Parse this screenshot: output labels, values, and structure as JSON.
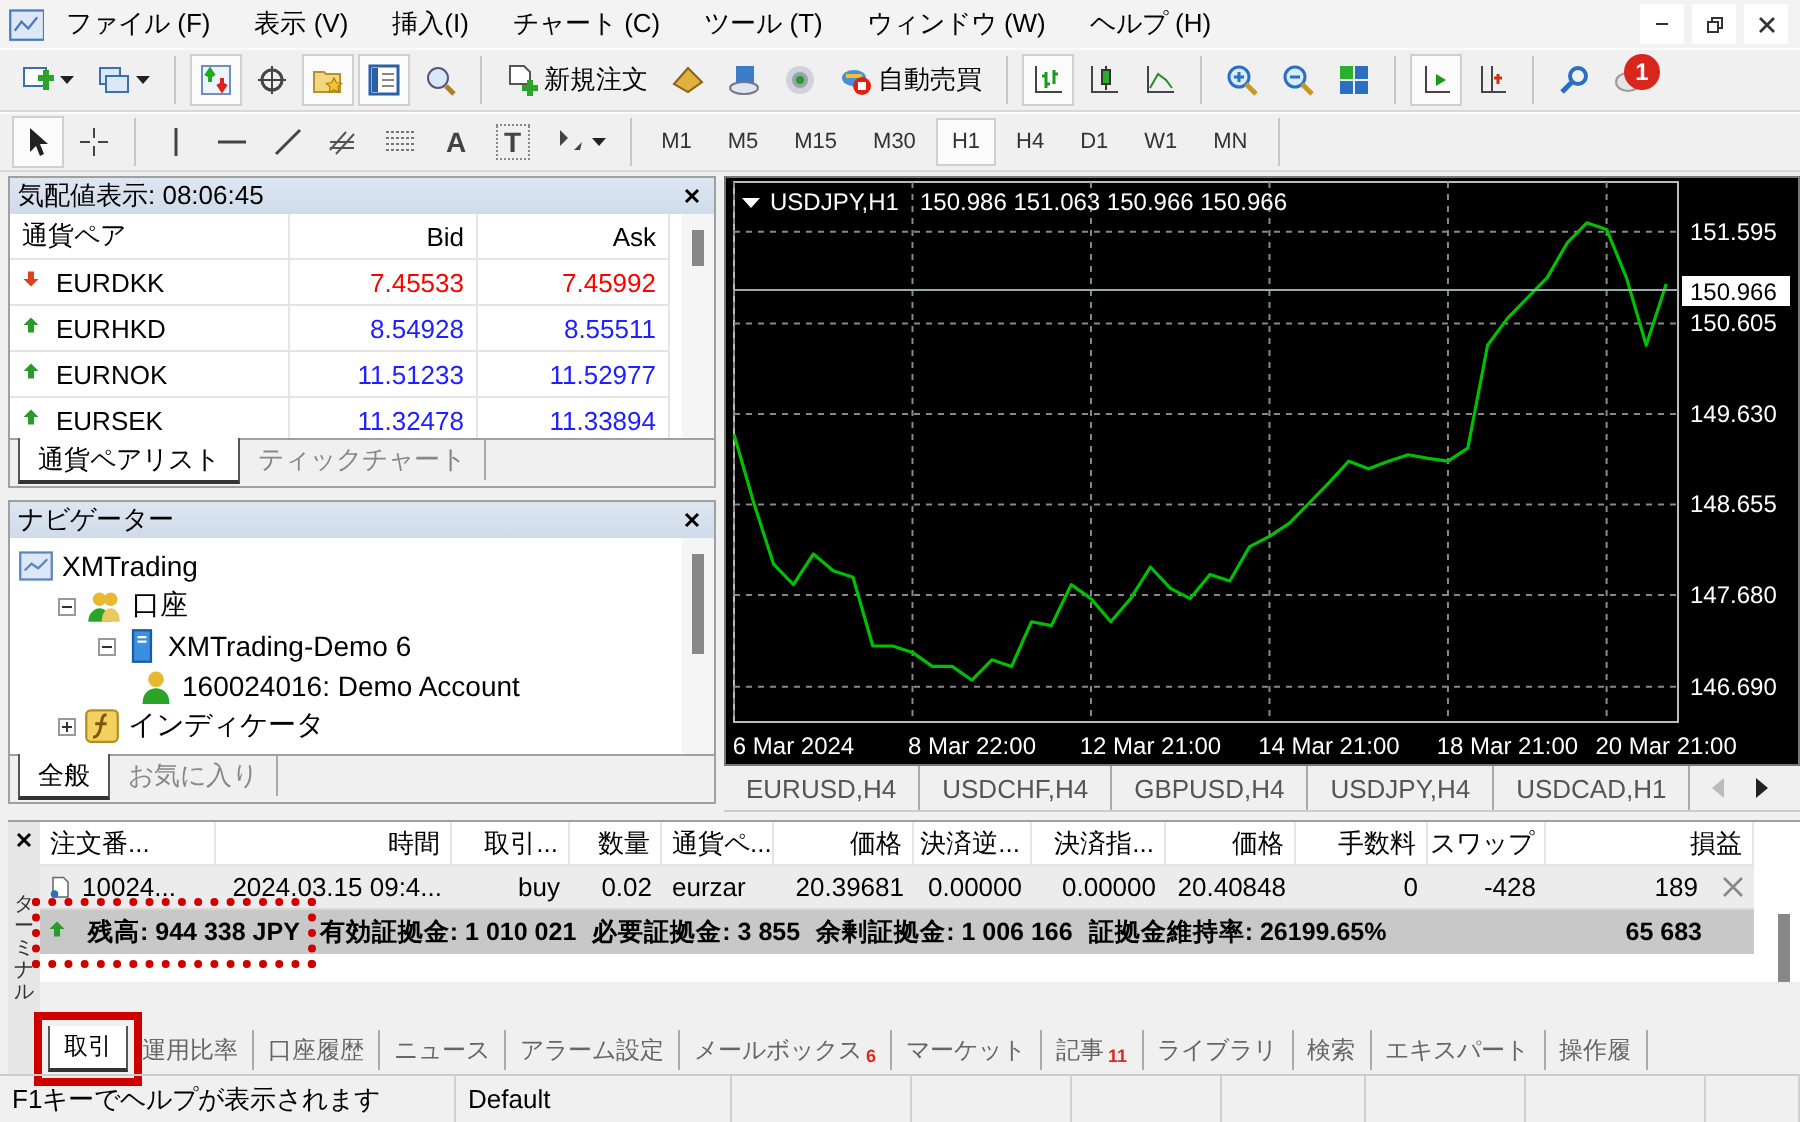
{
  "menu": [
    "ファイル (F)",
    "表示 (V)",
    "挿入(I)",
    "チャート (C)",
    "ツール (T)",
    "ウィンドウ (W)",
    "ヘルプ (H)"
  ],
  "toolbar_main": [
    {
      "kind": "new-chart",
      "pressed": false
    },
    {
      "kind": "profiles",
      "pressed": false
    },
    {
      "kind": "separator"
    },
    {
      "kind": "market-watch",
      "pressed": true
    },
    {
      "kind": "data-window",
      "pressed": false
    },
    {
      "kind": "navigator",
      "pressed": true
    },
    {
      "kind": "terminal",
      "pressed": true
    },
    {
      "kind": "tester",
      "pressed": false
    },
    {
      "kind": "separator"
    },
    {
      "kind": "new-order",
      "label": "新規注文"
    },
    {
      "kind": "editor",
      "pressed": false
    },
    {
      "kind": "cloud",
      "pressed": false
    },
    {
      "kind": "signals",
      "pressed": false
    },
    {
      "kind": "auto-trading",
      "label": "自動売買"
    },
    {
      "kind": "separator"
    },
    {
      "kind": "bars",
      "pressed": true
    },
    {
      "kind": "candles",
      "pressed": false
    },
    {
      "kind": "line",
      "pressed": false
    },
    {
      "kind": "separator"
    },
    {
      "kind": "zoom-in",
      "pressed": false
    },
    {
      "kind": "zoom-out",
      "pressed": false
    },
    {
      "kind": "tile",
      "pressed": false
    },
    {
      "kind": "separator"
    },
    {
      "kind": "autoscroll",
      "pressed": true
    },
    {
      "kind": "shift",
      "pressed": false
    },
    {
      "kind": "separator"
    },
    {
      "kind": "search",
      "pressed": false
    },
    {
      "kind": "chat",
      "badge": "1"
    }
  ],
  "toolbar_draw": [
    {
      "kind": "cursor",
      "pressed": true
    },
    {
      "kind": "crosshair",
      "pressed": false
    },
    {
      "kind": "separator"
    },
    {
      "kind": "vline",
      "pressed": false
    },
    {
      "kind": "hline",
      "pressed": false
    },
    {
      "kind": "trend",
      "pressed": false
    },
    {
      "kind": "fib-e",
      "pressed": false
    },
    {
      "kind": "fib-f",
      "pressed": false
    },
    {
      "kind": "text",
      "label": "A",
      "pressed": false
    },
    {
      "kind": "label",
      "label": "T",
      "pressed": false
    },
    {
      "kind": "arrows",
      "pressed": false
    }
  ],
  "timeframes": [
    {
      "label": "M1",
      "selected": false
    },
    {
      "label": "M5",
      "selected": false
    },
    {
      "label": "M15",
      "selected": false
    },
    {
      "label": "M30",
      "selected": false
    },
    {
      "label": "H1",
      "selected": true
    },
    {
      "label": "H4",
      "selected": false
    },
    {
      "label": "D1",
      "selected": false
    },
    {
      "label": "W1",
      "selected": false
    },
    {
      "label": "MN",
      "selected": false
    }
  ],
  "market_watch": {
    "title": "気配値表示: 08:06:45",
    "columns": [
      "通貨ペア",
      "Bid",
      "Ask"
    ],
    "rows": [
      {
        "symbol": "EURDKK",
        "bid": "7.45533",
        "ask": "7.45992",
        "kind": "down"
      },
      {
        "symbol": "EURHKD",
        "bid": "8.54928",
        "ask": "8.55511",
        "kind": "up"
      },
      {
        "symbol": "EURNOK",
        "bid": "11.51233",
        "ask": "11.52977",
        "kind": "up"
      },
      {
        "symbol": "EURSEK",
        "bid": "11.32478",
        "ask": "11.33894",
        "kind": "up"
      }
    ],
    "tabs": [
      {
        "label": "通貨ペアリスト",
        "selected": true
      },
      {
        "label": "ティックチャート",
        "selected": false
      }
    ]
  },
  "navigator": {
    "title": "ナビゲーター",
    "tree": [
      {
        "label": "XMTrading",
        "kind": "root",
        "children": [
          {
            "label": "口座",
            "kind": "accounts",
            "expanded": true,
            "children": [
              {
                "label": "XMTrading-Demo 6",
                "kind": "server",
                "expanded": true,
                "children": [
                  {
                    "label": "160024016: Demo Account",
                    "kind": "account"
                  }
                ]
              }
            ]
          },
          {
            "label": "インディケータ",
            "kind": "indicators",
            "expanded": false
          }
        ]
      }
    ],
    "tabs": [
      {
        "label": "全般",
        "selected": true
      },
      {
        "label": "お気に入り",
        "selected": false
      }
    ]
  },
  "chart": {
    "symbol": "USDJPY,H1",
    "ohlc": "150.986 151.063 150.966 150.966",
    "chart_data": {
      "type": "line",
      "grid": true,
      "categories": [
        null,
        null,
        null,
        "6 Mar 2024",
        null,
        null,
        null,
        null,
        null,
        null,
        null,
        null,
        "8 Mar 22:00",
        null,
        null,
        null,
        null,
        null,
        null,
        null,
        null,
        "12 Mar 21:00",
        null,
        null,
        null,
        null,
        null,
        null,
        null,
        null,
        "14 Mar 21:00",
        null,
        null,
        null,
        null,
        null,
        null,
        null,
        null,
        "18 Mar 21:00",
        null,
        null,
        null,
        null,
        null,
        null,
        null,
        "20 Mar 21:00"
      ],
      "series": [
        {
          "color": "#00c000",
          "values": [
            149.41,
            148.67,
            148.01,
            147.79,
            148.12,
            147.94,
            147.87,
            147.13,
            147.13,
            147.06,
            146.91,
            146.91,
            146.76,
            146.98,
            146.91,
            147.39,
            147.35,
            147.79,
            147.64,
            147.39,
            147.64,
            147.98,
            147.75,
            147.64,
            147.9,
            147.83,
            148.2,
            148.31,
            148.45,
            148.67,
            148.89,
            149.12,
            149.04,
            149.12,
            149.19,
            149.15,
            149.12,
            149.26,
            150.37,
            150.66,
            150.88,
            151.1,
            151.47,
            151.69,
            151.62,
            151.1,
            150.37,
            151.03
          ]
        }
      ],
      "ylim": [
        146.31,
        152.13
      ],
      "ref_lines": [
        {
          "axis": "y",
          "value": 150.966,
          "label": "150.966"
        }
      ],
      "yticks": [
        {
          "value": 151.595,
          "label": "151.595"
        },
        {
          "value": 150.605,
          "label": "150.605"
        },
        {
          "value": 149.63,
          "label": "149.630"
        },
        {
          "value": 148.655,
          "label": "148.655"
        },
        {
          "value": 147.68,
          "label": "147.680"
        },
        {
          "value": 146.69,
          "label": "146.690"
        }
      ]
    },
    "tabs": [
      "EURUSD,H4",
      "USDCHF,H4",
      "GBPUSD,H4",
      "USDJPY,H4",
      "USDCAD,H1"
    ]
  },
  "terminal": {
    "side_label": "ターミナル",
    "columns": [
      "注文番...",
      "時間",
      "取引...",
      "数量",
      "通貨ペ...",
      "価格",
      "決済逆...",
      "決済指...",
      "価格",
      "手数料",
      "スワップ",
      "損益"
    ],
    "orders": [
      {
        "cells": [
          "10024...",
          "2024.03.15 09:4...",
          "buy",
          "0.02",
          "eurzar",
          "20.39681",
          "0.00000",
          "0.00000",
          "20.40848",
          "0",
          "-428",
          "189"
        ]
      }
    ],
    "summary": {
      "balance": "残高: 944 338 JPY",
      "balance_highlighted": true,
      "metrics": [
        "有効証拠金: 1 010 021",
        "必要証拠金: 3 855",
        "余剰証拠金: 1 006 166",
        "証拠金維持率: 26199.65%"
      ],
      "profit": "65 683"
    },
    "tabs": [
      {
        "label": "取引",
        "selected": true,
        "highlighted": true
      },
      {
        "label": "運用比率",
        "selected": false,
        "highlighted": false
      },
      {
        "label": "口座履歴",
        "selected": false,
        "highlighted": false
      },
      {
        "label": "ニュース",
        "selected": false,
        "highlighted": false
      },
      {
        "label": "アラーム設定",
        "selected": false,
        "highlighted": false
      },
      {
        "label": "メールボックス",
        "badge": "6",
        "selected": false,
        "highlighted": false
      },
      {
        "label": "マーケット",
        "selected": false,
        "highlighted": false
      },
      {
        "label": "記事",
        "badge": "11",
        "selected": false,
        "highlighted": false
      },
      {
        "label": "ライブラリ",
        "selected": false,
        "highlighted": false
      },
      {
        "label": "検索",
        "selected": false,
        "highlighted": false
      },
      {
        "label": "エキスパート",
        "selected": false,
        "highlighted": false
      },
      {
        "label": "操作履",
        "selected": false,
        "highlighted": false
      }
    ]
  },
  "status_bar": [
    "F1キーでヘルプが表示されます",
    "Default"
  ]
}
